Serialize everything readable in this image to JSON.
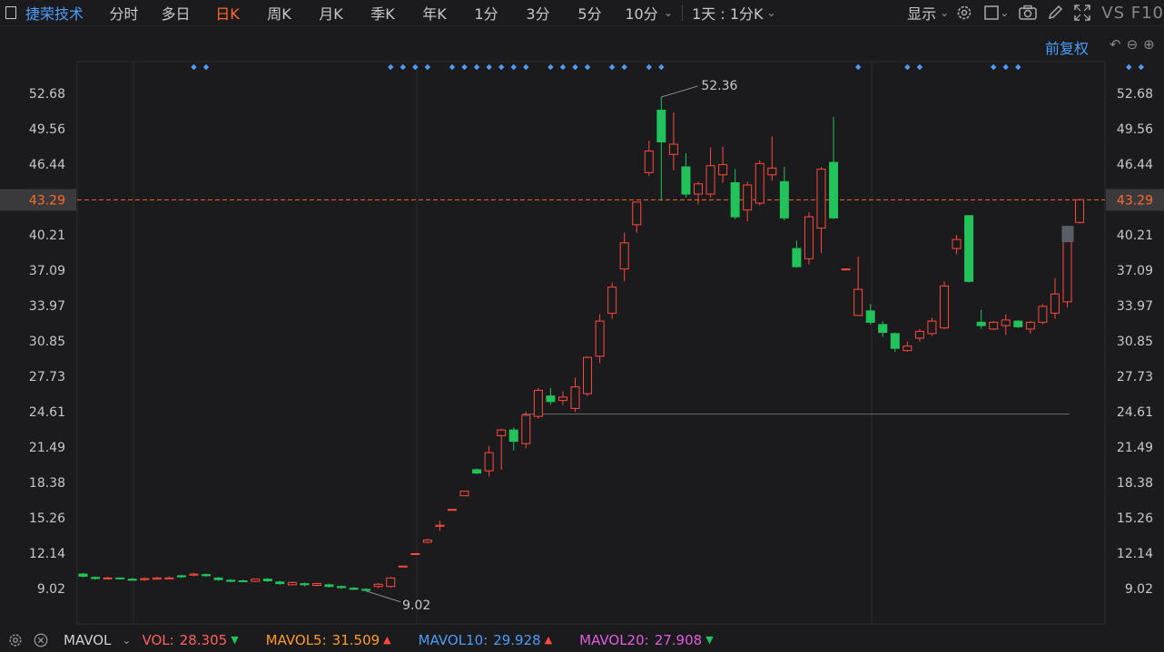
{
  "toolbar": {
    "stock_name": "捷荣技术",
    "periods": [
      "分时",
      "多日",
      "日K",
      "周K",
      "月K",
      "季K",
      "年K",
      "1分",
      "3分",
      "5分",
      "10分"
    ],
    "active_period": "日K",
    "compare_label": "1天 : 1分K",
    "display_label": "显示",
    "f10_label": "VS F10"
  },
  "adjust_label": "前复权",
  "indicator": {
    "name": "MAVOL",
    "vol_label": "VOL:",
    "vol_value": "28.305",
    "mavol5_label": "MAVOL5:",
    "mavol5_value": "31.509",
    "mavol10_label": "MAVOL10:",
    "mavol10_value": "29.928",
    "mavol20_label": "MAVOL20:",
    "mavol20_value": "27.908",
    "colors": {
      "vol": "#ff6060",
      "mavol5": "#ff9a2e",
      "mavol10": "#4d9cf8",
      "mavol20": "#e05ce0"
    }
  },
  "colors": {
    "up": "#ff4a3d",
    "down": "#22c35a",
    "grid": "#2a2a2c",
    "axis_text": "#c8c8c8",
    "current": "#ff6a2a",
    "marker": "#4d9cf8"
  },
  "chart_data": {
    "type": "candlestick",
    "y_ticks": [
      "52.68",
      "49.56",
      "46.44",
      "43.29",
      "40.21",
      "37.09",
      "33.97",
      "30.85",
      "27.73",
      "24.61",
      "21.49",
      "18.38",
      "15.26",
      "12.14",
      "9.02"
    ],
    "ylim": [
      9.02,
      52.68
    ],
    "current_price": "43.29",
    "high_label": "52.36",
    "low_label": "9.02",
    "support_level": 24.4,
    "candles": [
      {
        "o": 10.3,
        "c": 10.1,
        "h": 10.4,
        "l": 10.0
      },
      {
        "o": 10.0,
        "c": 9.9,
        "h": 10.1,
        "l": 9.8
      },
      {
        "o": 9.9,
        "c": 9.95,
        "h": 10.05,
        "l": 9.85
      },
      {
        "o": 9.95,
        "c": 9.9,
        "h": 10.0,
        "l": 9.8
      },
      {
        "o": 9.85,
        "c": 9.75,
        "h": 9.95,
        "l": 9.7
      },
      {
        "o": 9.8,
        "c": 9.9,
        "h": 10.0,
        "l": 9.7
      },
      {
        "o": 9.85,
        "c": 9.95,
        "h": 10.05,
        "l": 9.8
      },
      {
        "o": 9.95,
        "c": 9.95,
        "h": 10.1,
        "l": 9.85
      },
      {
        "o": 10.15,
        "c": 10.05,
        "h": 10.25,
        "l": 9.95
      },
      {
        "o": 10.2,
        "c": 10.3,
        "h": 10.4,
        "l": 10.1
      },
      {
        "o": 10.25,
        "c": 10.15,
        "h": 10.35,
        "l": 10.05
      },
      {
        "o": 9.95,
        "c": 9.8,
        "h": 10.05,
        "l": 9.7
      },
      {
        "o": 9.75,
        "c": 9.65,
        "h": 9.85,
        "l": 9.6
      },
      {
        "o": 9.7,
        "c": 9.65,
        "h": 9.8,
        "l": 9.6
      },
      {
        "o": 9.65,
        "c": 9.85,
        "h": 9.9,
        "l": 9.6
      },
      {
        "o": 9.85,
        "c": 9.7,
        "h": 9.95,
        "l": 9.6
      },
      {
        "o": 9.6,
        "c": 9.45,
        "h": 9.7,
        "l": 9.35
      },
      {
        "o": 9.35,
        "c": 9.55,
        "h": 9.65,
        "l": 9.3
      },
      {
        "o": 9.45,
        "c": 9.35,
        "h": 9.55,
        "l": 9.2
      },
      {
        "o": 9.3,
        "c": 9.45,
        "h": 9.55,
        "l": 9.2
      },
      {
        "o": 9.35,
        "c": 9.2,
        "h": 9.45,
        "l": 9.1
      },
      {
        "o": 9.2,
        "c": 9.1,
        "h": 9.3,
        "l": 9.0
      },
      {
        "o": 9.05,
        "c": 8.95,
        "h": 9.15,
        "l": 8.9
      },
      {
        "o": 8.95,
        "c": 8.85,
        "h": 9.05,
        "l": 8.8
      },
      {
        "o": 9.2,
        "c": 9.4,
        "h": 9.5,
        "l": 9.05
      },
      {
        "o": 9.2,
        "c": 9.95,
        "h": 10.05,
        "l": 9.1
      },
      {
        "o": 11.0,
        "c": 11.0,
        "h": 11.0,
        "l": 11.0
      },
      {
        "o": 12.1,
        "c": 12.1,
        "h": 12.1,
        "l": 12.1
      },
      {
        "o": 13.1,
        "c": 13.3,
        "h": 13.4,
        "l": 13.0
      },
      {
        "o": 14.5,
        "c": 14.6,
        "h": 15.0,
        "l": 14.1
      },
      {
        "o": 16.0,
        "c": 16.0,
        "h": 16.0,
        "l": 16.0
      },
      {
        "o": 17.2,
        "c": 17.6,
        "h": 17.6,
        "l": 17.2
      },
      {
        "o": 19.5,
        "c": 19.2,
        "h": 19.6,
        "l": 19.1
      },
      {
        "o": 19.4,
        "c": 21.0,
        "h": 21.6,
        "l": 18.9
      },
      {
        "o": 22.5,
        "c": 23.0,
        "h": 23.1,
        "l": 19.5
      },
      {
        "o": 23.0,
        "c": 22.0,
        "h": 23.2,
        "l": 21.2
      },
      {
        "o": 21.8,
        "c": 24.3,
        "h": 24.6,
        "l": 21.4
      },
      {
        "o": 24.2,
        "c": 26.5,
        "h": 26.7,
        "l": 24.0
      },
      {
        "o": 26.0,
        "c": 25.5,
        "h": 26.7,
        "l": 25.2
      },
      {
        "o": 25.6,
        "c": 25.9,
        "h": 26.4,
        "l": 25.2
      },
      {
        "o": 24.9,
        "c": 26.8,
        "h": 27.6,
        "l": 24.6
      },
      {
        "o": 26.2,
        "c": 29.4,
        "h": 29.5,
        "l": 26.0
      },
      {
        "o": 29.5,
        "c": 32.6,
        "h": 33.2,
        "l": 28.9
      },
      {
        "o": 33.3,
        "c": 35.6,
        "h": 36.0,
        "l": 32.8
      },
      {
        "o": 37.2,
        "c": 39.5,
        "h": 40.4,
        "l": 36.1
      },
      {
        "o": 41.1,
        "c": 43.1,
        "h": 43.1,
        "l": 40.4
      },
      {
        "o": 45.7,
        "c": 47.6,
        "h": 48.5,
        "l": 45.4
      },
      {
        "o": 51.2,
        "c": 48.4,
        "h": 52.36,
        "l": 43.2
      },
      {
        "o": 47.3,
        "c": 48.2,
        "h": 51.0,
        "l": 45.9
      },
      {
        "o": 46.2,
        "c": 43.8,
        "h": 47.4,
        "l": 43.5
      },
      {
        "o": 43.8,
        "c": 44.7,
        "h": 44.9,
        "l": 42.9
      },
      {
        "o": 43.8,
        "c": 46.3,
        "h": 47.9,
        "l": 43.5
      },
      {
        "o": 45.5,
        "c": 46.4,
        "h": 48.0,
        "l": 44.8
      },
      {
        "o": 44.8,
        "c": 41.8,
        "h": 46.0,
        "l": 41.6
      },
      {
        "o": 42.4,
        "c": 44.6,
        "h": 44.9,
        "l": 41.4
      },
      {
        "o": 43.0,
        "c": 46.5,
        "h": 46.8,
        "l": 42.8
      },
      {
        "o": 45.5,
        "c": 46.1,
        "h": 48.9,
        "l": 45.0
      },
      {
        "o": 44.9,
        "c": 41.7,
        "h": 46.2,
        "l": 41.5
      },
      {
        "o": 39.0,
        "c": 37.4,
        "h": 39.7,
        "l": 37.3
      },
      {
        "o": 38.1,
        "c": 41.8,
        "h": 42.2,
        "l": 37.6
      },
      {
        "o": 40.8,
        "c": 46.0,
        "h": 46.2,
        "l": 38.6
      },
      {
        "o": 46.6,
        "c": 41.7,
        "h": 50.6,
        "l": 41.6
      },
      {
        "o": 37.2,
        "c": 37.2,
        "h": 37.2,
        "l": 37.2
      },
      {
        "o": 33.1,
        "c": 35.4,
        "h": 38.3,
        "l": 33.1
      },
      {
        "o": 33.5,
        "c": 32.5,
        "h": 34.1,
        "l": 32.3
      },
      {
        "o": 32.3,
        "c": 31.6,
        "h": 32.6,
        "l": 31.2
      },
      {
        "o": 31.5,
        "c": 30.2,
        "h": 31.6,
        "l": 29.9
      },
      {
        "o": 30.0,
        "c": 30.4,
        "h": 30.8,
        "l": 29.9
      },
      {
        "o": 31.1,
        "c": 31.7,
        "h": 31.9,
        "l": 30.8
      },
      {
        "o": 31.5,
        "c": 32.6,
        "h": 32.9,
        "l": 31.3
      },
      {
        "o": 32.0,
        "c": 35.7,
        "h": 36.1,
        "l": 31.9
      },
      {
        "o": 39.0,
        "c": 39.8,
        "h": 40.2,
        "l": 38.5
      },
      {
        "o": 41.9,
        "c": 36.1,
        "h": 41.9,
        "l": 36.0
      },
      {
        "o": 32.5,
        "c": 32.2,
        "h": 33.6,
        "l": 31.9
      },
      {
        "o": 31.9,
        "c": 32.5,
        "h": 32.6,
        "l": 31.8
      },
      {
        "o": 32.2,
        "c": 32.7,
        "h": 33.2,
        "l": 31.4
      },
      {
        "o": 32.6,
        "c": 32.1,
        "h": 32.7,
        "l": 32.0
      },
      {
        "o": 31.9,
        "c": 32.5,
        "h": 32.6,
        "l": 31.5
      },
      {
        "o": 32.5,
        "c": 33.9,
        "h": 34.1,
        "l": 32.3
      },
      {
        "o": 33.3,
        "c": 35.0,
        "h": 36.4,
        "l": 32.8
      },
      {
        "o": 34.3,
        "c": 39.6,
        "h": 40.7,
        "l": 33.8
      },
      {
        "o": 41.3,
        "c": 43.3,
        "h": 43.4,
        "l": 41.2
      }
    ],
    "markers": [
      9,
      10,
      25,
      26,
      27,
      28,
      30,
      31,
      32,
      33,
      34,
      35,
      36,
      38,
      39,
      40,
      41,
      43,
      44,
      46,
      47,
      63,
      67,
      68,
      74,
      75,
      76,
      85,
      86
    ]
  }
}
